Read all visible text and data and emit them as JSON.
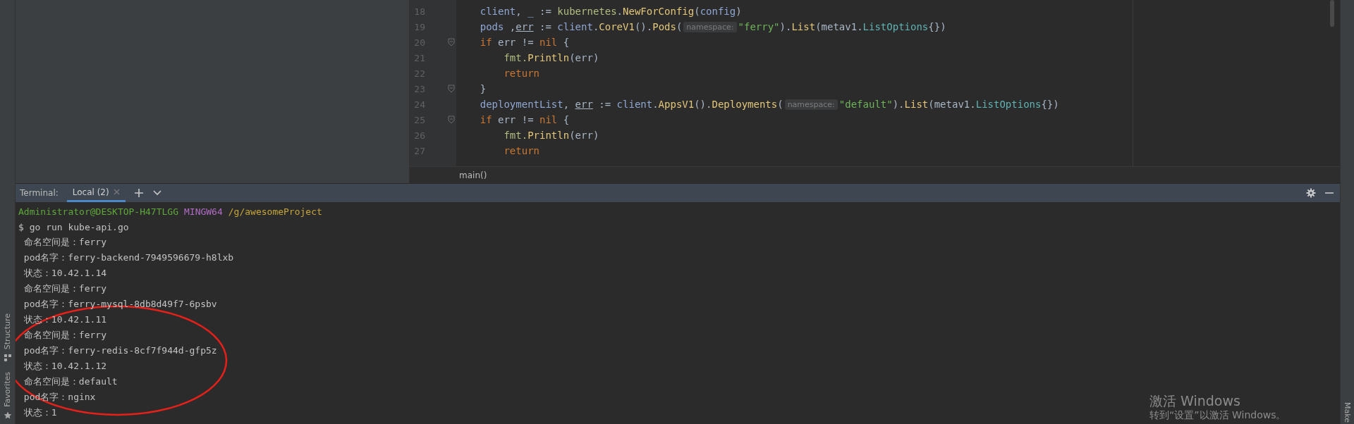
{
  "editor": {
    "lines": [
      {
        "number": "18",
        "fold": false,
        "tokens": [
          {
            "t": "    client",
            "kind": "var"
          },
          {
            "t": ", ",
            "kind": "plain"
          },
          {
            "t": "_",
            "kind": "var"
          },
          {
            "t": " := ",
            "kind": "plain"
          },
          {
            "t": "kubernetes",
            "kind": "pkg"
          },
          {
            "t": ".",
            "kind": "plain"
          },
          {
            "t": "NewForConfig",
            "kind": "func"
          },
          {
            "t": "(",
            "kind": "plain"
          },
          {
            "t": "config",
            "kind": "var"
          },
          {
            "t": ")",
            "kind": "plain"
          }
        ]
      },
      {
        "number": "19",
        "fold": false,
        "tokens": [
          {
            "t": "    pods",
            "kind": "var"
          },
          {
            "t": " ,",
            "kind": "plain"
          },
          {
            "t": "err",
            "kind": "under"
          },
          {
            "t": " := ",
            "kind": "plain"
          },
          {
            "t": "client",
            "kind": "var"
          },
          {
            "t": ".",
            "kind": "plain"
          },
          {
            "t": "CoreV1",
            "kind": "func"
          },
          {
            "t": "().",
            "kind": "plain"
          },
          {
            "t": "Pods",
            "kind": "func"
          },
          {
            "t": "(",
            "kind": "plain"
          },
          {
            "t": "namespace:",
            "kind": "hint"
          },
          {
            "t": "\"ferry\"",
            "kind": "string"
          },
          {
            "t": ").",
            "kind": "plain"
          },
          {
            "t": "List",
            "kind": "func"
          },
          {
            "t": "(",
            "kind": "plain"
          },
          {
            "t": "metav1.",
            "kind": "plain"
          },
          {
            "t": "ListOptions",
            "kind": "type"
          },
          {
            "t": "{})",
            "kind": "plain"
          }
        ]
      },
      {
        "number": "20",
        "fold": true,
        "tokens": [
          {
            "t": "    if",
            "kind": "keyword"
          },
          {
            "t": " err != ",
            "kind": "plain"
          },
          {
            "t": "nil",
            "kind": "keyword"
          },
          {
            "t": " {",
            "kind": "plain"
          }
        ]
      },
      {
        "number": "21",
        "fold": false,
        "tokens": [
          {
            "t": "        fmt.",
            "kind": "pkg"
          },
          {
            "t": "Println",
            "kind": "func"
          },
          {
            "t": "(err)",
            "kind": "plain"
          }
        ]
      },
      {
        "number": "22",
        "fold": false,
        "tokens": [
          {
            "t": "        return",
            "kind": "keyword"
          }
        ]
      },
      {
        "number": "23",
        "fold": true,
        "tokens": [
          {
            "t": "    }",
            "kind": "plain"
          }
        ]
      },
      {
        "number": "24",
        "fold": false,
        "tokens": [
          {
            "t": "    deploymentList",
            "kind": "var"
          },
          {
            "t": ", ",
            "kind": "plain"
          },
          {
            "t": "err",
            "kind": "under"
          },
          {
            "t": " := ",
            "kind": "plain"
          },
          {
            "t": "client",
            "kind": "var"
          },
          {
            "t": ".",
            "kind": "plain"
          },
          {
            "t": "AppsV1",
            "kind": "func"
          },
          {
            "t": "().",
            "kind": "plain"
          },
          {
            "t": "Deployments",
            "kind": "func"
          },
          {
            "t": "(",
            "kind": "plain"
          },
          {
            "t": "namespace:",
            "kind": "hint"
          },
          {
            "t": "\"default\"",
            "kind": "string"
          },
          {
            "t": ").",
            "kind": "plain"
          },
          {
            "t": "List",
            "kind": "func"
          },
          {
            "t": "(",
            "kind": "plain"
          },
          {
            "t": "metav1.",
            "kind": "plain"
          },
          {
            "t": "ListOptions",
            "kind": "type"
          },
          {
            "t": "{})",
            "kind": "plain"
          }
        ]
      },
      {
        "number": "25",
        "fold": true,
        "tokens": [
          {
            "t": "    if",
            "kind": "keyword"
          },
          {
            "t": " err != ",
            "kind": "plain"
          },
          {
            "t": "nil",
            "kind": "keyword"
          },
          {
            "t": " {",
            "kind": "plain"
          }
        ]
      },
      {
        "number": "26",
        "fold": false,
        "tokens": [
          {
            "t": "        fmt.",
            "kind": "pkg"
          },
          {
            "t": "Println",
            "kind": "func"
          },
          {
            "t": "(err)",
            "kind": "plain"
          }
        ]
      },
      {
        "number": "27",
        "fold": false,
        "tokens": [
          {
            "t": "        return",
            "kind": "keyword"
          }
        ]
      }
    ],
    "breadcrumb": "main()"
  },
  "terminal": {
    "label": "Terminal:",
    "tabs": [
      {
        "label": "Local (2)",
        "selected": true
      }
    ],
    "lines": [
      {
        "kind": "prompt",
        "user": "Administrator@DESKTOP-H47TLGG",
        "system": "MINGW64",
        "path": "/g/awesomeProject"
      },
      {
        "kind": "output",
        "text": "$ go run kube-api.go"
      },
      {
        "kind": "output",
        "text": " 命名空间是：ferry"
      },
      {
        "kind": "output",
        "text": " pod名字：ferry-backend-7949596679-h8lxb"
      },
      {
        "kind": "output",
        "text": " 状态：10.42.1.14"
      },
      {
        "kind": "output",
        "text": " 命名空间是：ferry"
      },
      {
        "kind": "output",
        "text": " pod名字：ferry-mysql-8db8d49f7-6psbv"
      },
      {
        "kind": "output",
        "text": " 状态：10.42.1.11"
      },
      {
        "kind": "output",
        "text": " 命名空间是：ferry"
      },
      {
        "kind": "output",
        "text": " pod名字：ferry-redis-8cf7f944d-gfp5z"
      },
      {
        "kind": "output",
        "text": " 状态：10.42.1.12"
      },
      {
        "kind": "output",
        "text": " 命名空间是：default"
      },
      {
        "kind": "output",
        "text": " pod名字：nginx"
      },
      {
        "kind": "output",
        "text": " 状态：1"
      }
    ]
  },
  "left_strip": [
    "Structure",
    "Favorites"
  ],
  "right_strip": [
    "Make"
  ],
  "os_notice": {
    "title": "激活 Windows",
    "message": "转到“设置”以激活 Windows。"
  }
}
